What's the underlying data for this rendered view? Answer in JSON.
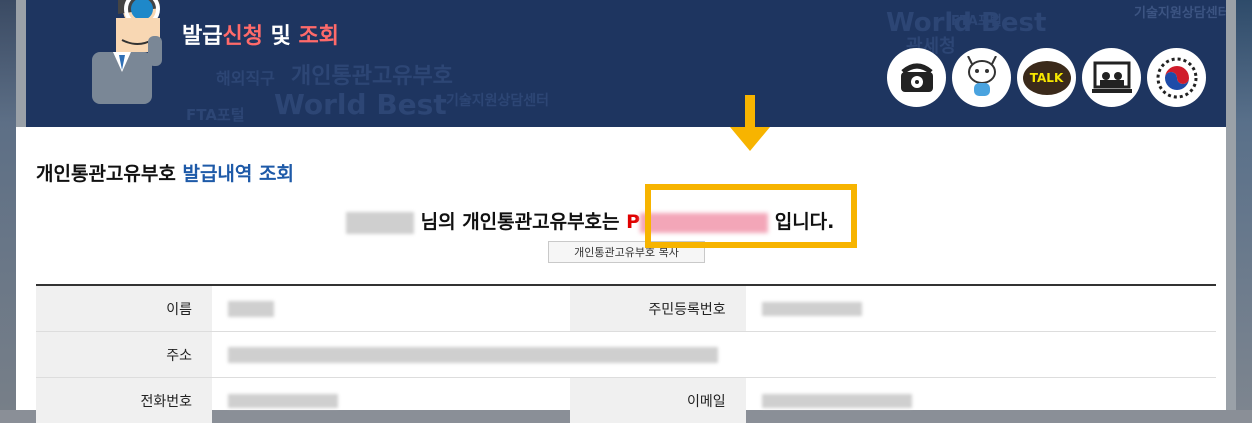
{
  "header": {
    "title_parts": [
      "발급",
      "신청",
      " 및 ",
      "조회"
    ],
    "watermarks": [
      "World Best",
      "개인통관고유부호",
      "FTA포털",
      "기술지원상담센터",
      "해외직구",
      "World Best",
      "FTA포털",
      "기술지원상담센터",
      "관세청"
    ],
    "icons": [
      {
        "name": "phone-icon"
      },
      {
        "name": "chatbot-icon"
      },
      {
        "name": "talk-icon",
        "label": "TALK"
      },
      {
        "name": "remote-support-icon"
      },
      {
        "name": "government-emblem-icon"
      }
    ]
  },
  "content": {
    "heading_prefix": "개인통관고유부호",
    "heading_suffix": "발급내역 조회",
    "message_middle": "님의 개인통관고유부호는",
    "code_prefix": "P",
    "message_end": "입니다.",
    "button_label": "개인통관고유부호 복사"
  },
  "table": {
    "rows": [
      [
        {
          "label": "이름"
        },
        {
          "label": "주민등록번호"
        }
      ],
      [
        {
          "label": "주소"
        }
      ],
      [
        {
          "label": "전화번호"
        },
        {
          "label": "이메일"
        }
      ]
    ]
  },
  "colors": {
    "header_bg": "#1e3560",
    "highlight": "#f7b400",
    "accent_blue": "#1e5aa8",
    "accent_red": "#e00000"
  }
}
